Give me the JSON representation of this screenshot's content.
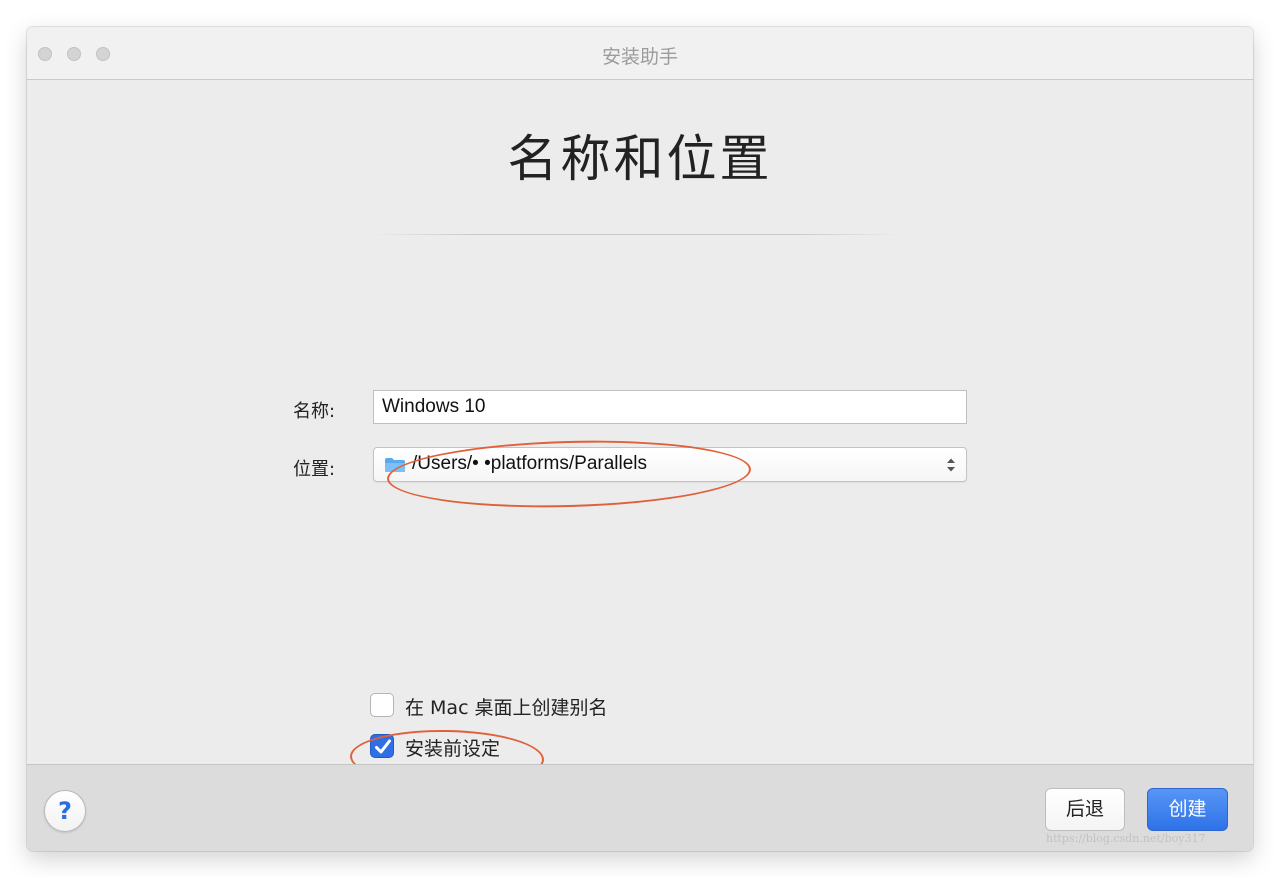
{
  "window": {
    "title": "安装助手"
  },
  "page": {
    "heading": "名称和位置"
  },
  "form": {
    "name_label": "名称:",
    "name_value": "Windows 10",
    "location_label": "位置:",
    "location_value": "/Users/• •platforms/Parallels"
  },
  "options": {
    "alias_label": "在 Mac 桌面上创建别名",
    "alias_checked": false,
    "preset_label": "安装前设定",
    "preset_checked": true
  },
  "footer": {
    "help_label": "?",
    "back_label": "后退",
    "create_label": "创建"
  },
  "watermark": {
    "text": "https://blog.csdn.net/boy317"
  },
  "colors": {
    "accent": "#2f72e8",
    "annotation": "#e0603a"
  }
}
